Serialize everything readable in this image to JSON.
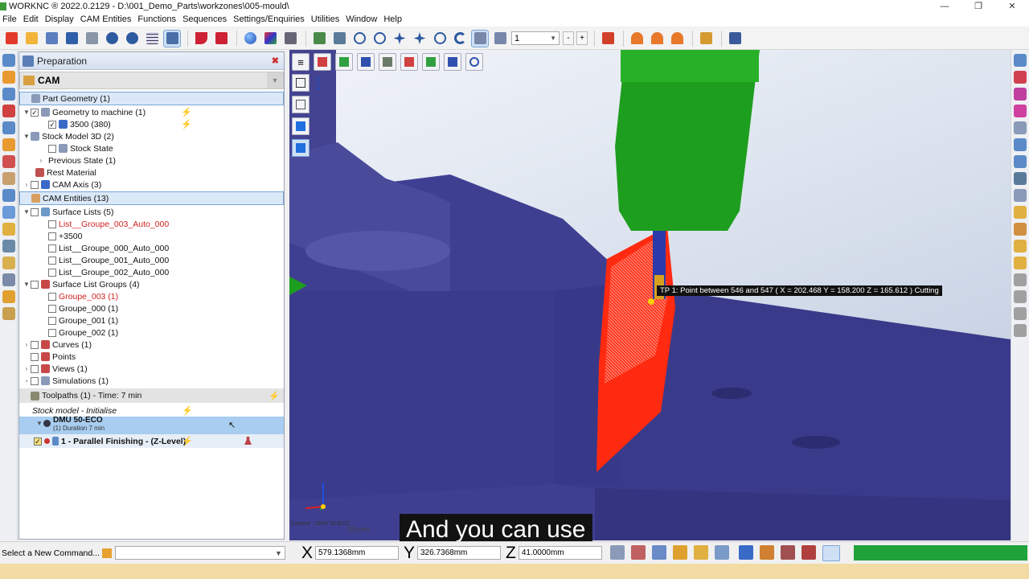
{
  "window": {
    "title": "WORKNC ® 2022.0.2129 - D:\\001_Demo_Parts\\workzones\\005-mould\\",
    "min": "—",
    "max": "❐",
    "close": "✕"
  },
  "menu": [
    "File",
    "Edit",
    "Display",
    "CAM Entities",
    "Functions",
    "Sequences",
    "Settings/Enquiries",
    "Utilities",
    "Window",
    "Help"
  ],
  "toolbar": {
    "layer_value": "1",
    "minus": "-",
    "plus": "+"
  },
  "panel": {
    "title": "Preparation",
    "close": "✖",
    "cam_label": "CAM",
    "tree": {
      "part_geometry": "Part Geometry (1)",
      "geometry_to_machine": "Geometry to machine (1)",
      "g3500": "3500 (380)",
      "stock_model": "Stock Model 3D (2)",
      "stock_state": "Stock State",
      "previous_state": "Previous State (1)",
      "rest_material": "Rest Material",
      "cam_axis": "CAM Axis (3)",
      "cam_entities": "CAM Entities (13)",
      "surface_lists": "Surface Lists (5)",
      "sl_items": [
        "List__Groupe_003_Auto_000",
        "+3500",
        "List__Groupe_000_Auto_000",
        "List__Groupe_001_Auto_000",
        "List__Groupe_002_Auto_000"
      ],
      "surface_list_groups": "Surface List Groups (4)",
      "slg_items": [
        "Groupe_003 (1)",
        "Groupe_000 (1)",
        "Groupe_001 (1)",
        "Groupe_002 (1)"
      ],
      "curves": "Curves (1)",
      "points": "Points",
      "views": "Views (1)",
      "simulations": "Simulations (1)",
      "toolpaths": "Toolpaths (1) - Time: 7 min",
      "stock_init": "Stock model - Initialise",
      "machine": "DMU 50-ECO",
      "duration": "(1) Duration 7 min",
      "toolpath": "1 - Parallel Finishing - (Z-Level)"
    }
  },
  "viewport": {
    "tooltip": "TP 1: Point between 546 and 547 ( X = 202.468  Y = 158.200  Z = 165.612 ) Cutting",
    "context": "Context : DMU 50-ECO",
    "scale": "20(mm)",
    "axis_label": "Y\nZ"
  },
  "subtitle": "And you can use",
  "status": {
    "command_label": "Select a New Command...",
    "x_label": "X",
    "x_value": "579.1368mm",
    "y_label": "Y",
    "y_value": "326.7368mm",
    "z_label": "Z",
    "z_value": "41.0000mm"
  },
  "colors": {
    "accent": "#3aa02c",
    "tool_green": "#1e9e1e",
    "part_blue": "#3d3d8f",
    "toolpath_red": "#ff2a10"
  }
}
